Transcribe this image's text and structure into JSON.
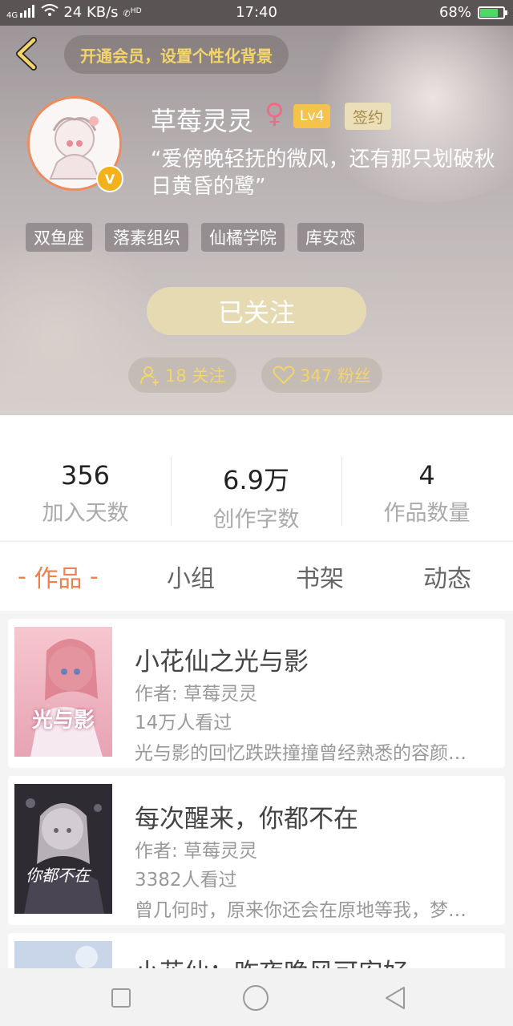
{
  "status_bar": {
    "network": "4G",
    "speed": "24 KB/s",
    "hd": "HD",
    "time": "17:40",
    "battery": "68%"
  },
  "header": {
    "vip_promo": "开通会员，设置个性化背景",
    "username": "草莓灵灵",
    "gender_symbol": "♀",
    "level": "Lv4",
    "signed": "签约",
    "vip_badge": "V",
    "motto": "“爱傍晚轻抚的微风，还有那只划破秋日黄昏的鹭”",
    "tags": [
      "双鱼座",
      "落素组织",
      "仙橘学院",
      "库安恋"
    ],
    "follow_button": "已关注",
    "following": "18 关注",
    "fans": "347 粉丝"
  },
  "stats": [
    {
      "value": "356",
      "label": "加入天数"
    },
    {
      "value": "6.9万",
      "label": "创作字数"
    },
    {
      "value": "4",
      "label": "作品数量"
    }
  ],
  "tabs": [
    {
      "label": "作品",
      "active": true
    },
    {
      "label": "小组",
      "active": false
    },
    {
      "label": "书架",
      "active": false
    },
    {
      "label": "动态",
      "active": false
    }
  ],
  "works": [
    {
      "title": "小花仙之光与影",
      "author": "作者: 草莓灵灵",
      "views": "14万人看过",
      "desc": "光与影的回忆跌跌撞撞曾经熟悉的容颜…",
      "cover_text": "光与影"
    },
    {
      "title": "每次醒来，你都不在",
      "author": "作者: 草莓灵灵",
      "views": "3382人看过",
      "desc": "曾几何时，原来你还会在原地等我，梦…",
      "cover_text": "你都不在"
    },
    {
      "title": "小花仙：昨夜晚风可安好",
      "author": "",
      "views": "",
      "desc": ""
    }
  ],
  "colors": {
    "accent_orange": "#f0804f",
    "gold_text": "#f3d56b",
    "avatar_ring": "#f08a5d"
  }
}
